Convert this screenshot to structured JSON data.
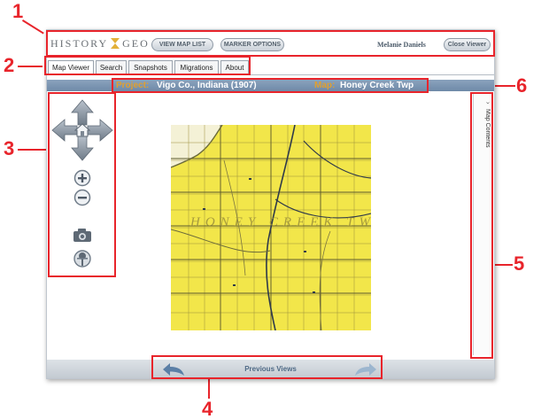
{
  "app": {
    "logo_part1": "HISTORY",
    "logo_part2": "GEO"
  },
  "header": {
    "view_map_list": "VIEW MAP LIST",
    "marker_options": "MARKER OPTIONS",
    "user_name": "Melanie Daniels",
    "close_viewer": "Close Viewer"
  },
  "tabs": [
    {
      "label": "Map Viewer",
      "active": true
    },
    {
      "label": "Search",
      "active": false
    },
    {
      "label": "Snapshots",
      "active": false
    },
    {
      "label": "Migrations",
      "active": false
    },
    {
      "label": "About",
      "active": false
    }
  ],
  "titlebar": {
    "project_key": "Project:",
    "project_value": "Vigo Co., Indiana (1907)",
    "map_key": "Map:",
    "map_value": "Honey Creek Twp"
  },
  "map": {
    "overlay_text": "HONEY CREEK TWP"
  },
  "side_panel": {
    "label": "Map Contents",
    "chevron": "›"
  },
  "footer": {
    "label": "Previous Views"
  },
  "callouts": [
    "1",
    "2",
    "3",
    "4",
    "5",
    "6"
  ],
  "colors": {
    "callout_red": "#e8242b",
    "titlebar_blue": "#7a93b0",
    "title_key": "#e0a030",
    "map_yellow": "#f2e64a",
    "control_grey": "#7d8894"
  },
  "icons": {
    "pan": "pan-arrows-icon",
    "home": "home-icon",
    "zoom_in": "zoom-in-icon",
    "zoom_out": "zoom-out-icon",
    "snapshot": "camera-icon",
    "marker": "pin-icon",
    "back": "back-arrow-icon",
    "forward": "forward-arrow-icon"
  }
}
